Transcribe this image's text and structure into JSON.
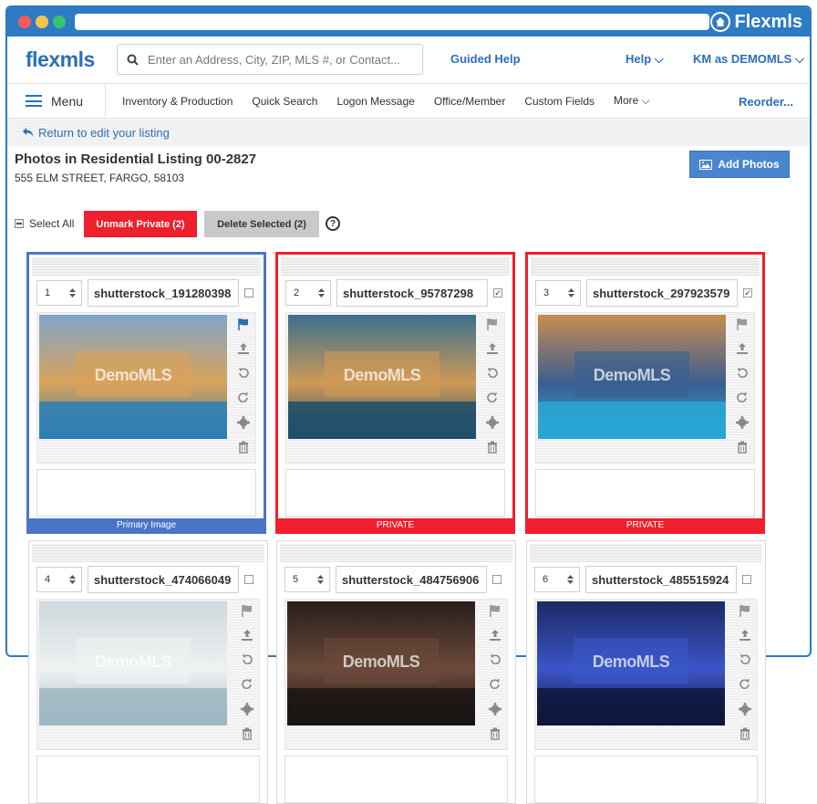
{
  "window": {
    "brand": "Flexmls"
  },
  "header": {
    "logo": "flexmls",
    "search_placeholder": "Enter an Address, City, ZIP, MLS #, or Contact...",
    "guided_help": "Guided Help",
    "help": "Help ⌵",
    "user": "KM as DEMOMLS ⌵"
  },
  "nav": {
    "menu": "Menu",
    "items": [
      "Inventory & Production",
      "Quick Search",
      "Logon Message",
      "Office/Member",
      "Custom Fields",
      "More ⌵"
    ],
    "reorder": "Reorder..."
  },
  "return_link": "Return to edit your listing",
  "page": {
    "title": "Photos in Residential Listing 00-2827",
    "address": "555 ELM STREET, FARGO, 58103",
    "add_photos": "Add Photos"
  },
  "toolbar": {
    "select_all": "Select All",
    "unmark_private": "Unmark Private (2)",
    "delete_selected": "Delete Selected (2)",
    "help_glyph": "?"
  },
  "watermark": "DemoMLS",
  "photos": [
    {
      "order": "1",
      "filename": "shutterstock_191280398",
      "checked": false,
      "status": "Primary Image",
      "colors": [
        "#7fa6c8",
        "#d9a25a",
        "#2d7fb4"
      ]
    },
    {
      "order": "2",
      "filename": "shutterstock_95787298",
      "checked": true,
      "status": "PRIVATE",
      "colors": [
        "#3a6f8f",
        "#cf9a56",
        "#1e4d6b"
      ]
    },
    {
      "order": "3",
      "filename": "shutterstock_297923579",
      "checked": true,
      "status": "PRIVATE",
      "colors": [
        "#c88b52",
        "#3b5f90",
        "#2aa7d6"
      ]
    },
    {
      "order": "4",
      "filename": "shutterstock_474066049",
      "checked": false,
      "status": "",
      "colors": [
        "#cfd8dc",
        "#eef1f2",
        "#9fb6c2"
      ]
    },
    {
      "order": "5",
      "filename": "shutterstock_484756906",
      "checked": false,
      "status": "",
      "colors": [
        "#2a1e1c",
        "#6b4a3a",
        "#1a1414"
      ]
    },
    {
      "order": "6",
      "filename": "shutterstock_485515924",
      "checked": false,
      "status": "",
      "colors": [
        "#1c2a66",
        "#3b56c8",
        "#0f163a"
      ]
    }
  ]
}
